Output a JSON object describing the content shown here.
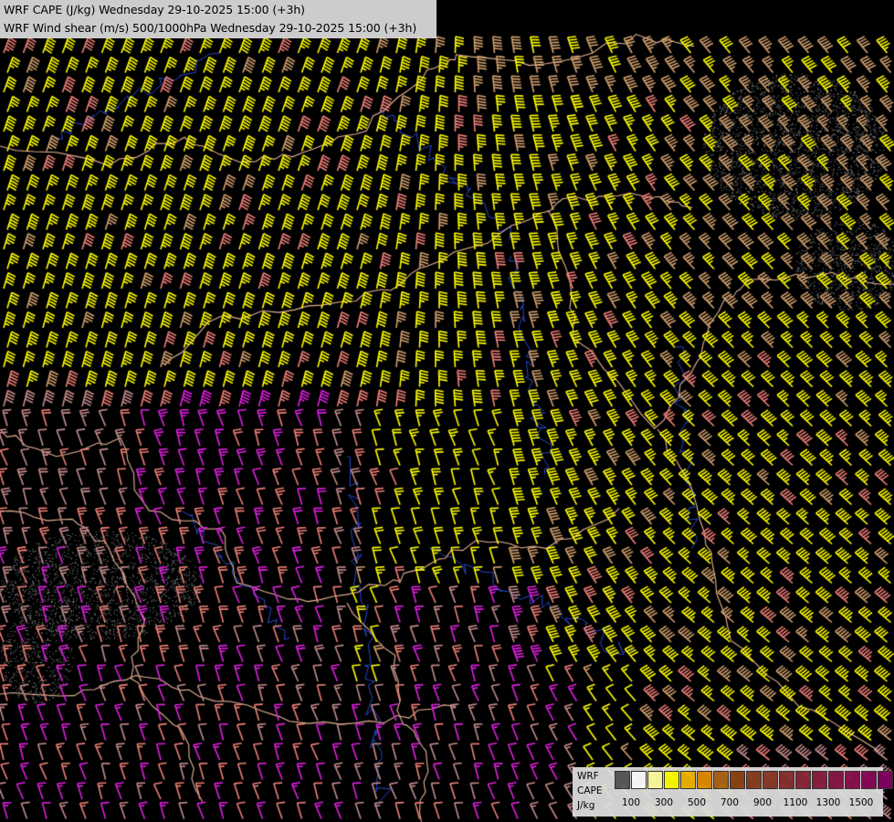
{
  "title": {
    "line1": "WRF CAPE (J/kg) Wednesday 29-10-2025 15:00 (+3h)",
    "line2": "WRF Wind shear (m/s) 500/1000hPa Wednesday 29-10-2025 15:00 (+3h)"
  },
  "legend": {
    "label_model": "WRF",
    "label_field": "CAPE",
    "label_unit": "J/kg",
    "colors": [
      "#5a5a5a",
      "#ffffff",
      "#ffffa0",
      "#ffff00",
      "#f0b400",
      "#e08c00",
      "#b06418",
      "#8c4614",
      "#8a4020",
      "#8c3c28",
      "#8c3030",
      "#8c2838",
      "#8c2040",
      "#8c1848",
      "#8c1050",
      "#8c0858",
      "#800060",
      "#780068",
      "#700070"
    ],
    "tick_labels": [
      "100",
      "300",
      "500",
      "700",
      "900",
      "1100",
      "1300",
      "1500"
    ]
  },
  "barb_colors": {
    "yellow": "#ffff00",
    "tan": "#d2a06e",
    "salmon": "#f08078",
    "magenta": "#e020e0",
    "rose": "#c88c8c"
  },
  "map_colors": {
    "background": "#000000",
    "border": "#e6b496",
    "river": "#2848c8",
    "stipple": "#909090"
  }
}
